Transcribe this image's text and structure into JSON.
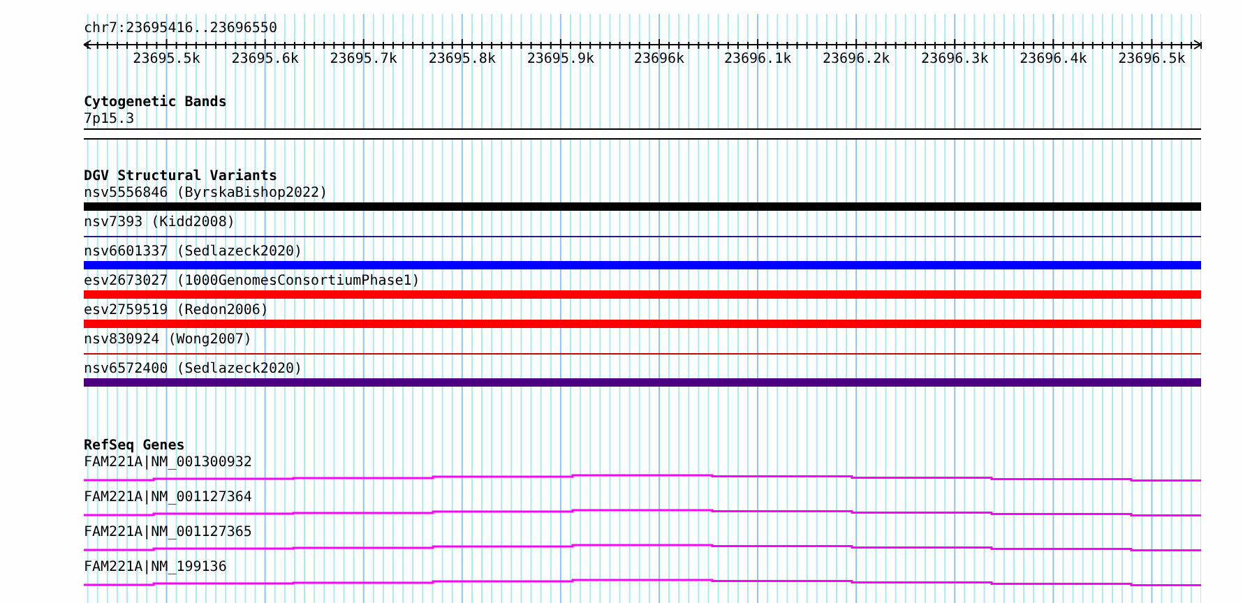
{
  "ruler": {
    "position": "chr7:23695416..23696550",
    "tick_labels": [
      "23695.5k",
      "23695.6k",
      "23695.7k",
      "23695.8k",
      "23695.9k",
      "23696k",
      "23696.1k",
      "23696.2k",
      "23696.3k",
      "23696.4k",
      "23696.5k"
    ]
  },
  "cytogenetic_bands": {
    "title": "Cytogenetic Bands",
    "band": "7p15.3"
  },
  "dgv_structural_variants": {
    "title": "DGV Structural Variants",
    "items": [
      {
        "label": "nsv5556846 (ByrskaBishop2022)",
        "kind": "bar",
        "color": "#000000"
      },
      {
        "label": "nsv7393 (Kidd2008)",
        "kind": "line",
        "color": "#2a1a7a"
      },
      {
        "label": "nsv6601337 (Sedlazeck2020)",
        "kind": "bar",
        "color": "#0000ff"
      },
      {
        "label": "esv2673027 (1000GenomesConsortiumPhase1)",
        "kind": "bar",
        "color": "#ff0000"
      },
      {
        "label": "esv2759519 (Redon2006)",
        "kind": "bar",
        "color": "#ff0000"
      },
      {
        "label": "nsv830924 (Wong2007)",
        "kind": "line",
        "color": "#cc0000"
      },
      {
        "label": "nsv6572400 (Sedlazeck2020)",
        "kind": "bar",
        "color": "#4b0082"
      }
    ]
  },
  "refseq_genes": {
    "title": "RefSeq Genes",
    "items": [
      {
        "label": "FAM221A|NM_001300932"
      },
      {
        "label": "FAM221A|NM_001127364"
      },
      {
        "label": "FAM221A|NM_001127365"
      },
      {
        "label": "FAM221A|NM_199136"
      }
    ]
  }
}
